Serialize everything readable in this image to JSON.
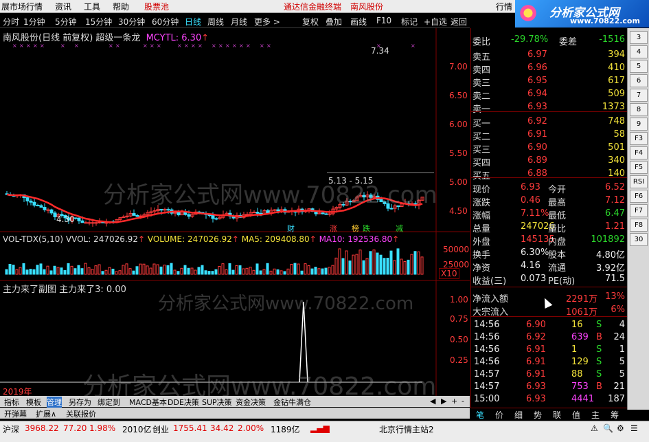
{
  "menu": {
    "items": [
      "展市场行情",
      "资讯",
      "工具",
      "帮助"
    ],
    "watchlist": "股票池",
    "title_left": "通达信金融终端",
    "title_right": "南风股份",
    "right_item": "行情"
  },
  "toolbar": {
    "periods": [
      "分时",
      "1分钟",
      "5分钟",
      "15分钟",
      "30分钟",
      "60分钟",
      "日线",
      "周线",
      "月线",
      "更多 >"
    ],
    "selected_period": "日线",
    "buttons": [
      "复权",
      "叠加",
      "画线",
      "F10",
      "标记",
      "+自选",
      "返回"
    ]
  },
  "logo": {
    "brand": "分析家公式网",
    "url": "www.70822.com"
  },
  "main_chart": {
    "title": "南风股份(日线 前复权) 超级一条龙",
    "indicator": "MCYTL: 6.30",
    "price_high_label": "7.34",
    "price_low_label": "4.30",
    "range_label": "5.13 - 5.15",
    "axis_labels": [
      "7.00",
      "6.50",
      "6.00",
      "5.50",
      "5.00",
      "4.50"
    ],
    "event_tags": [
      "财",
      "涨",
      "榜",
      "跌",
      "减"
    ],
    "watermark": "分析家公式网www.70822.com"
  },
  "volume_chart": {
    "label_name": "VOL-TDX(5,10)",
    "vvol": "VVOL: 247026.92",
    "volume": "VOLUME: 247026.92",
    "ma5": "MA5: 209408.80",
    "ma10": "MA10: 192536.80",
    "axis_labels": [
      "50000",
      "25000"
    ],
    "unit": "X10"
  },
  "sub_chart": {
    "title": "主力来了副图 主力来了3: 0.00",
    "axis_labels": [
      "1.00",
      "0.75",
      "0.50",
      "0.25"
    ],
    "watermark": "分析家公式网www.70822.com",
    "year_label": "2019年"
  },
  "bottom_tabs": {
    "row1": [
      "指标",
      "模板",
      "管理",
      "另存为",
      "绑定到",
      "MACD基本",
      "DDE决策",
      "SUP决策",
      "资金决策",
      "金钻牛满仓"
    ],
    "row1_selected": "管理",
    "row2": [
      "开弹幕",
      "扩展∧",
      "关联报价"
    ]
  },
  "order_book": {
    "weibi_label": "委比",
    "weibi_value": "-29.78%",
    "weicha_label": "委差",
    "weicha_value": "-1516",
    "asks": [
      {
        "label": "卖五",
        "price": "6.97",
        "vol": "394"
      },
      {
        "label": "卖四",
        "price": "6.96",
        "vol": "410"
      },
      {
        "label": "卖三",
        "price": "6.95",
        "vol": "617"
      },
      {
        "label": "卖二",
        "price": "6.94",
        "vol": "509"
      },
      {
        "label": "卖一",
        "price": "6.93",
        "vol": "1373"
      }
    ],
    "bids": [
      {
        "label": "买一",
        "price": "6.92",
        "vol": "748"
      },
      {
        "label": "买二",
        "price": "6.91",
        "vol": "58"
      },
      {
        "label": "买三",
        "price": "6.90",
        "vol": "501"
      },
      {
        "label": "买四",
        "price": "6.89",
        "vol": "340"
      },
      {
        "label": "买五",
        "price": "6.88",
        "vol": "140"
      }
    ]
  },
  "quote": {
    "rows": [
      {
        "l1": "现价",
        "v1": "6.93",
        "l2": "今开",
        "v2": "6.52"
      },
      {
        "l1": "涨跌",
        "v1": "0.46",
        "l2": "最高",
        "v2": "7.12"
      },
      {
        "l1": "涨幅",
        "v1": "7.11%",
        "l2": "最低",
        "v2": "6.47"
      },
      {
        "l1": "总量",
        "v1": "247026",
        "l2": "量比",
        "v2": "1.21"
      },
      {
        "l1": "外盘",
        "v1": "145135",
        "l2": "内盘",
        "v2": "101892"
      },
      {
        "l1": "换手",
        "v1": "6.30%",
        "l2": "股本",
        "v2": "4.80亿"
      },
      {
        "l1": "净资",
        "v1": "4.16",
        "l2": "流通",
        "v2": "3.92亿"
      },
      {
        "l1": "收益(三)",
        "v1": "0.073",
        "l2": "PE(动)",
        "v2": "71.5"
      }
    ],
    "flow": [
      {
        "label": "净流入额",
        "value": "2291万",
        "pct": "13%"
      },
      {
        "label": "大宗流入",
        "value": "1061万",
        "pct": "6%"
      }
    ]
  },
  "trades": [
    {
      "time": "14:56",
      "price": "6.90",
      "vol": "16",
      "side": "S",
      "n": "4"
    },
    {
      "time": "14:56",
      "price": "6.92",
      "vol": "639",
      "side": "B",
      "n": "24"
    },
    {
      "time": "14:56",
      "price": "6.91",
      "vol": "1",
      "side": "S",
      "n": "1"
    },
    {
      "time": "14:56",
      "price": "6.91",
      "vol": "129",
      "side": "S",
      "n": "5"
    },
    {
      "time": "14:57",
      "price": "6.91",
      "vol": "88",
      "side": "S",
      "n": "5"
    },
    {
      "time": "14:57",
      "price": "6.93",
      "vol": "753",
      "side": "B",
      "n": "21"
    },
    {
      "time": "15:00",
      "price": "6.93",
      "vol": "4441",
      "side": "",
      "n": "187"
    }
  ],
  "right_tabs": [
    "笔",
    "价",
    "细",
    "势",
    "联",
    "值",
    "主",
    "筹"
  ],
  "right_tools": [
    "3",
    "4",
    "5",
    "6",
    "7",
    "8",
    "9",
    "F3",
    "F4",
    "F5",
    "RSI",
    "F6",
    "F7",
    "F8",
    "30"
  ],
  "status": {
    "sh_name": "沪深",
    "sh_index": "3968.22",
    "sh_change": "77.20",
    "sh_pct": "1.98%",
    "sh_amount": "2010亿",
    "cy_name": "创业",
    "cy_index": "1755.41",
    "cy_change": "34.42",
    "cy_pct": "2.00%",
    "cy_amount": "1189亿",
    "server": "北京行情主站2"
  }
}
